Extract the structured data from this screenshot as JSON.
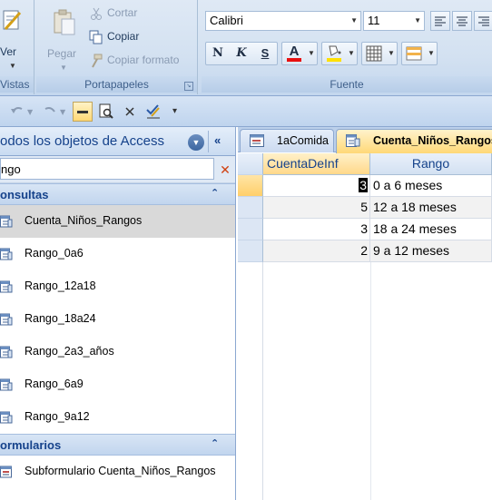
{
  "ribbon": {
    "views": {
      "ver_label": "Ver",
      "group_label": "Vistas"
    },
    "clipboard": {
      "paste_label": "Pegar",
      "cut_label": "Cortar",
      "copy_label": "Copiar",
      "format_painter_label": "Copiar formato",
      "group_label": "Portapapeles"
    },
    "font": {
      "font_name": "Calibri",
      "font_size": "11",
      "bold_label": "N",
      "italic_label": "K",
      "underline_label": "S",
      "font_color_label": "A",
      "font_color": "#e81010",
      "fill_color": "#ffe000",
      "group_label": "Fuente"
    }
  },
  "nav": {
    "title": "odos los objetos de Access",
    "search_value": "ngo",
    "sections": [
      {
        "label": "onsultas",
        "items": [
          {
            "label": "Cuenta_Niños_Rangos"
          },
          {
            "label": "Rango_0a6"
          },
          {
            "label": "Rango_12a18"
          },
          {
            "label": "Rango_18a24"
          },
          {
            "label": "Rango_2a3_años"
          },
          {
            "label": "Rango_6a9"
          },
          {
            "label": "Rango_9a12"
          }
        ]
      },
      {
        "label": "ormularios",
        "items": [
          {
            "label": "Subformulario Cuenta_Niños_Rangos"
          }
        ]
      }
    ]
  },
  "doc": {
    "tabs": [
      {
        "label": "1aComida"
      },
      {
        "label": "Cuenta_Niños_Rangos"
      }
    ],
    "columns": [
      "CuentaDeInf",
      "Rango"
    ],
    "rows": [
      {
        "count": "3",
        "rango": "0 a 6 meses"
      },
      {
        "count": "5",
        "rango": "12 a 18 meses"
      },
      {
        "count": "3",
        "rango": "18 a 24 meses"
      },
      {
        "count": "2",
        "rango": "9 a 12 meses"
      }
    ]
  }
}
